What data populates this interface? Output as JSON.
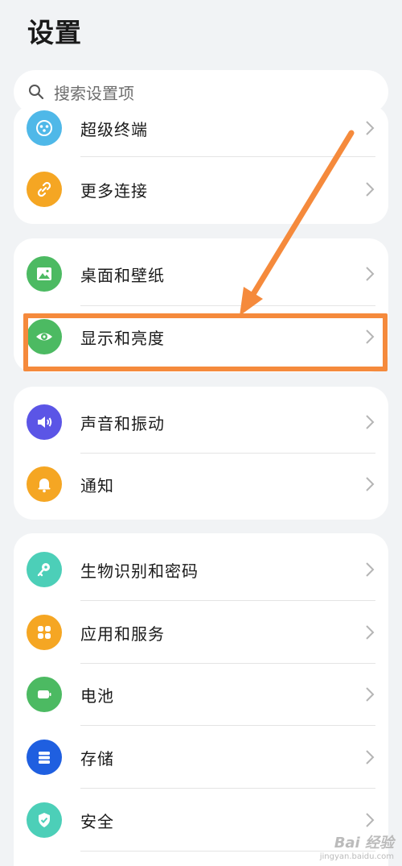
{
  "header": {
    "title": "设置"
  },
  "search": {
    "placeholder": "搜索设置项",
    "icon": "search-icon"
  },
  "groups": [
    {
      "items": [
        {
          "label": "超级终端",
          "icon": "super-device-icon",
          "color": "#4fb8e8"
        },
        {
          "label": "更多连接",
          "icon": "link-icon",
          "color": "#f5a623"
        }
      ]
    },
    {
      "items": [
        {
          "label": "桌面和壁纸",
          "icon": "image-icon",
          "color": "#4cba62"
        },
        {
          "label": "显示和亮度",
          "icon": "eye-icon",
          "color": "#4cba62"
        }
      ]
    },
    {
      "items": [
        {
          "label": "声音和振动",
          "icon": "speaker-icon",
          "color": "#5b55e6"
        },
        {
          "label": "通知",
          "icon": "bell-icon",
          "color": "#f5a623"
        }
      ]
    },
    {
      "items": [
        {
          "label": "生物识别和密码",
          "icon": "key-icon",
          "color": "#4ccfb8"
        },
        {
          "label": "应用和服务",
          "icon": "apps-icon",
          "color": "#f5a623"
        },
        {
          "label": "电池",
          "icon": "battery-icon",
          "color": "#4cba62"
        },
        {
          "label": "存储",
          "icon": "storage-icon",
          "color": "#1f5fe0"
        },
        {
          "label": "安全",
          "icon": "shield-icon",
          "color": "#4ccfb8"
        }
      ]
    }
  ],
  "annotation": {
    "highlight_color": "#f58a3c"
  },
  "watermark": {
    "line1": "Bai 经验",
    "line2": "jingyan.baidu.com"
  }
}
